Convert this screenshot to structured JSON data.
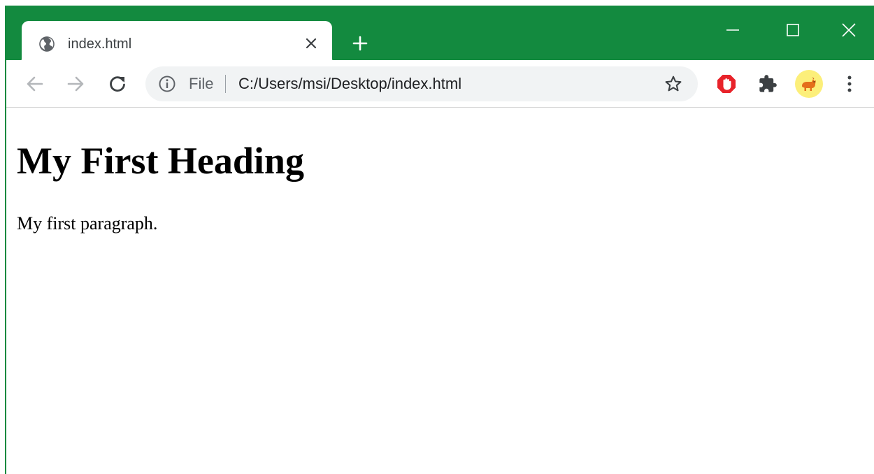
{
  "browser": {
    "theme_color": "#138a3f",
    "tab": {
      "title": "index.html",
      "icon": "globe-icon"
    },
    "window_controls": [
      "minimize-icon",
      "maximize-icon",
      "close-icon"
    ]
  },
  "toolbar": {
    "address_bar": {
      "scheme_label": "File",
      "url": "C:/Users/msi/Desktop/index.html"
    },
    "extensions": [
      "adblock-icon",
      "puzzle-icon",
      "profile-avatar"
    ]
  },
  "page": {
    "heading": "My First Heading",
    "paragraph": "My first paragraph."
  }
}
